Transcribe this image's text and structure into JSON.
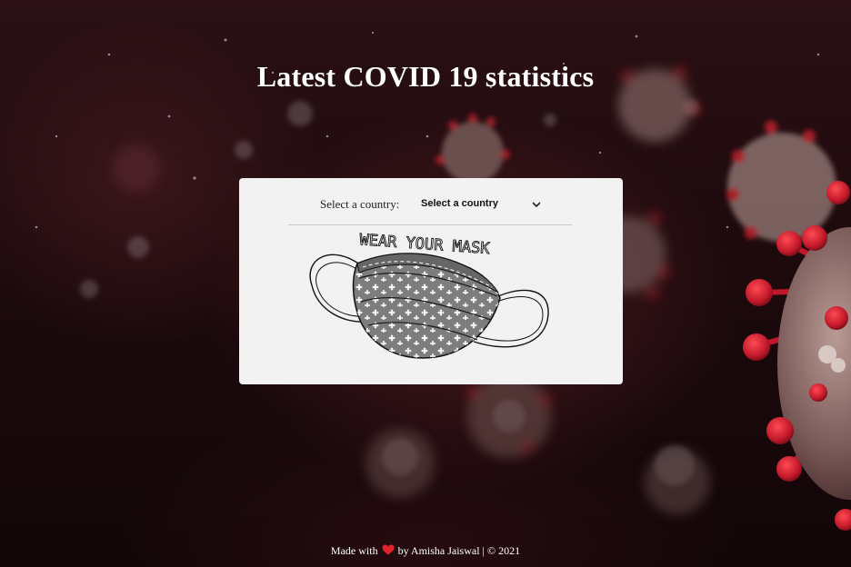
{
  "page": {
    "title": "Latest COVID 19 statistics"
  },
  "selector": {
    "label": "Select a country:",
    "selected": "Select a country"
  },
  "illustration": {
    "text": "WEAR YOUR MASK"
  },
  "footer": {
    "made_with": "Made with",
    "by": "by Amisha Jaiswal | © 2021"
  },
  "colors": {
    "card_background": "#f2f2f2",
    "heart": "#e0242c",
    "title_text": "#ffffff",
    "virus_red": "#c0232d"
  },
  "icons": {
    "select_chevron": "chevron-down-icon",
    "footer_heart": "heart-icon"
  }
}
